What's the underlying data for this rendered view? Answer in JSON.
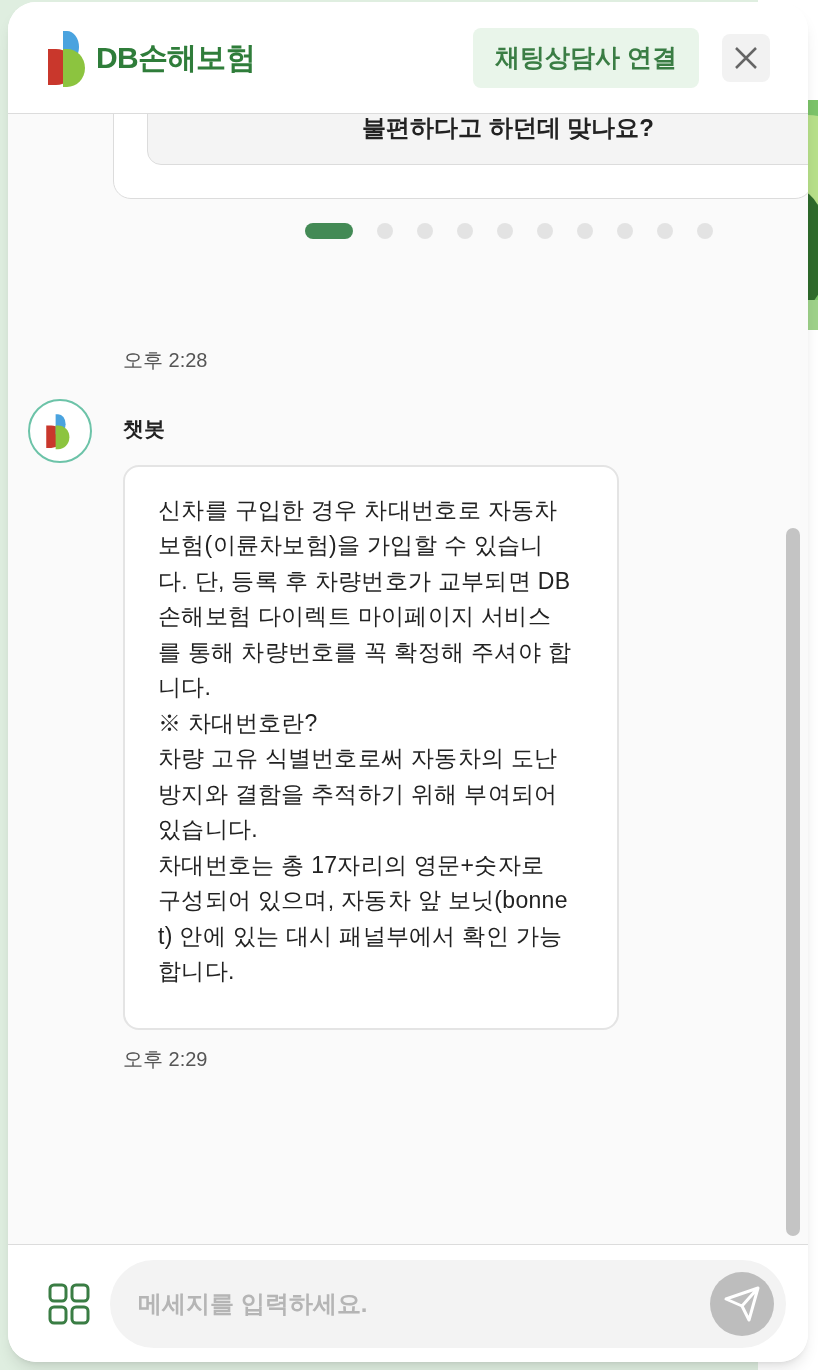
{
  "header": {
    "logo_text": "DB손해보험",
    "connect_button": "채팅상담사 연결"
  },
  "carousel": {
    "card_text": "불편하다고 하던데 맞나요?",
    "dots": [
      {
        "selected": true
      },
      {
        "selected": false
      },
      {
        "selected": false
      },
      {
        "selected": false
      },
      {
        "selected": false
      },
      {
        "selected": false
      },
      {
        "selected": false
      },
      {
        "selected": false
      },
      {
        "selected": false
      },
      {
        "selected": false
      }
    ]
  },
  "messages": [
    {
      "kind": "time",
      "text": "오후 2:28"
    },
    {
      "kind": "bot",
      "sender": "챗봇",
      "paragraphs": [
        "신차를 구입한 경우 차대번호로 자동차 보험(이륜차보험)을 가입할 수 있습니다. 단, 등록 후 차량번호가 교부되면 DB손해보험 다이렉트 마이페이지 서비스를 통해 차량번호를 꼭 확정해 주셔야 합니다.",
        "※ 차대번호란?",
        "차량 고유 식별번호로써 자동차의 도난방지와 결함을 추적하기 위해 부여되어 있습니다.",
        "차대번호는 총 17자리의 영문+숫자로 구성되어 있으며, 자동차 앞 보닛(bonnet) 안에 있는 대시 패널부에서 확인 가능합니다."
      ]
    },
    {
      "kind": "time",
      "text": "오후 2:29"
    }
  ],
  "composer": {
    "placeholder": "메세지를 입력하세요."
  }
}
